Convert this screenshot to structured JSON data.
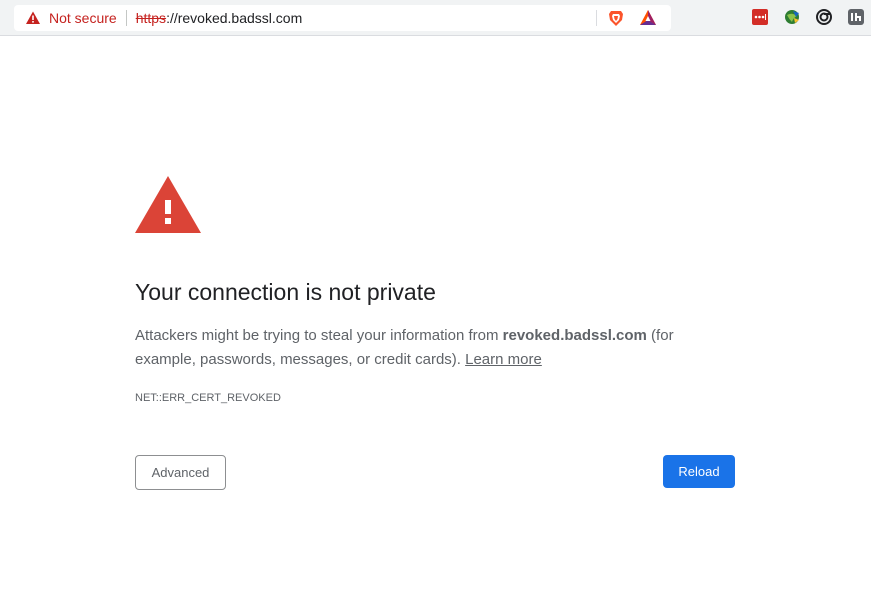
{
  "omnibox": {
    "security_label": "Not secure",
    "url_scheme": "https",
    "url_rest": "://revoked.badssl.com",
    "warning_color": "#c5221f"
  },
  "toolbar_icons": [
    "brave-shield-icon",
    "bat-rewards-icon"
  ],
  "extensions": [
    "lastpass-icon",
    "globe-extension-icon",
    "spiral-extension-icon",
    "tab-extension-icon"
  ],
  "interstitial": {
    "heading": "Your connection is not private",
    "explanation_prefix": "Attackers might be trying to steal your information from ",
    "explanation_host": "revoked.badssl.com",
    "explanation_suffix": " (for example, passwords, messages, or credit cards). ",
    "learn_more": "Learn more",
    "error_code": "NET::ERR_CERT_REVOKED",
    "icon": "warning-triangle-icon",
    "icon_color": "#db4437"
  },
  "buttons": {
    "advanced": "Advanced",
    "reload": "Reload",
    "reload_color": "#1a73e8"
  }
}
